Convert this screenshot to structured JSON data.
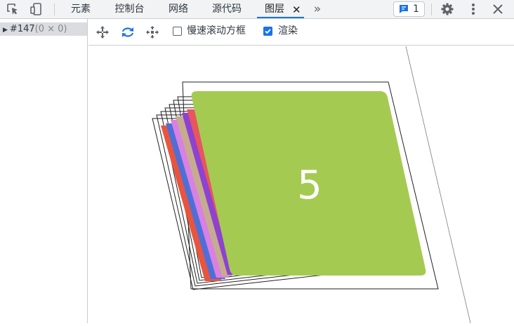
{
  "toolbar_top": {
    "tabs": [
      {
        "label": "元素",
        "active": false
      },
      {
        "label": "控制台",
        "active": false
      },
      {
        "label": "网络",
        "active": false
      },
      {
        "label": "源代码",
        "active": false
      },
      {
        "label": "图层",
        "active": true
      }
    ],
    "close_glyph": "✕",
    "overflow_glyph": "»",
    "issues_count": "1",
    "icons": [
      "inspect-element-icon",
      "device-toggle-icon",
      "chat-icon",
      "gear-icon",
      "kebab-menu-icon",
      "close-icon"
    ]
  },
  "tree": {
    "node_label": "#147",
    "node_size": "(0 × 0)"
  },
  "layers_toolbar": {
    "tools": [
      "pan-icon",
      "rotate-icon",
      "reset-view-icon"
    ],
    "slow_scroll_label": "慢速滚动方框",
    "slow_scroll_checked": false,
    "paint_label": "渲染",
    "paint_checked": true
  },
  "layer_stack": {
    "top_layer_number": "5",
    "layer_colors": [
      "#e8553e",
      "#4f6fd8",
      "#d980e3",
      "#c7ab8f",
      "#8d42d0",
      "#e8555e",
      "#a5ca52"
    ]
  }
}
